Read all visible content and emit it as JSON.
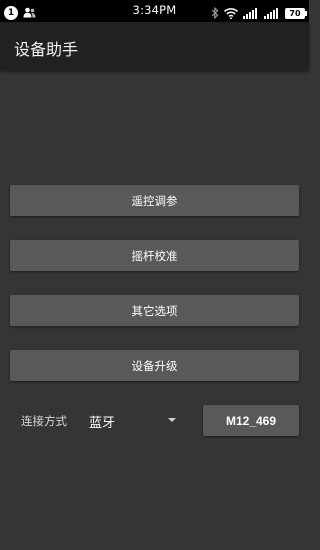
{
  "status_bar": {
    "notification_count": "1",
    "time": "3:34PM",
    "battery": "70"
  },
  "app_bar": {
    "title": "设备助手"
  },
  "menu": {
    "remote_tuning": "遥控调参",
    "stick_calibration": "摇杆校准",
    "other_options": "其它选项",
    "device_upgrade": "设备升级"
  },
  "connection": {
    "label": "连接方式",
    "selected": "蓝牙",
    "device": "M12_469"
  },
  "icons": {
    "notification": "notification-badge-icon",
    "contacts": "people-icon",
    "bluetooth": "bluetooth-icon",
    "wifi": "wifi-icon",
    "signal": "cellular-signal-icon",
    "battery": "battery-icon",
    "dropdown": "chevron-down-icon"
  }
}
